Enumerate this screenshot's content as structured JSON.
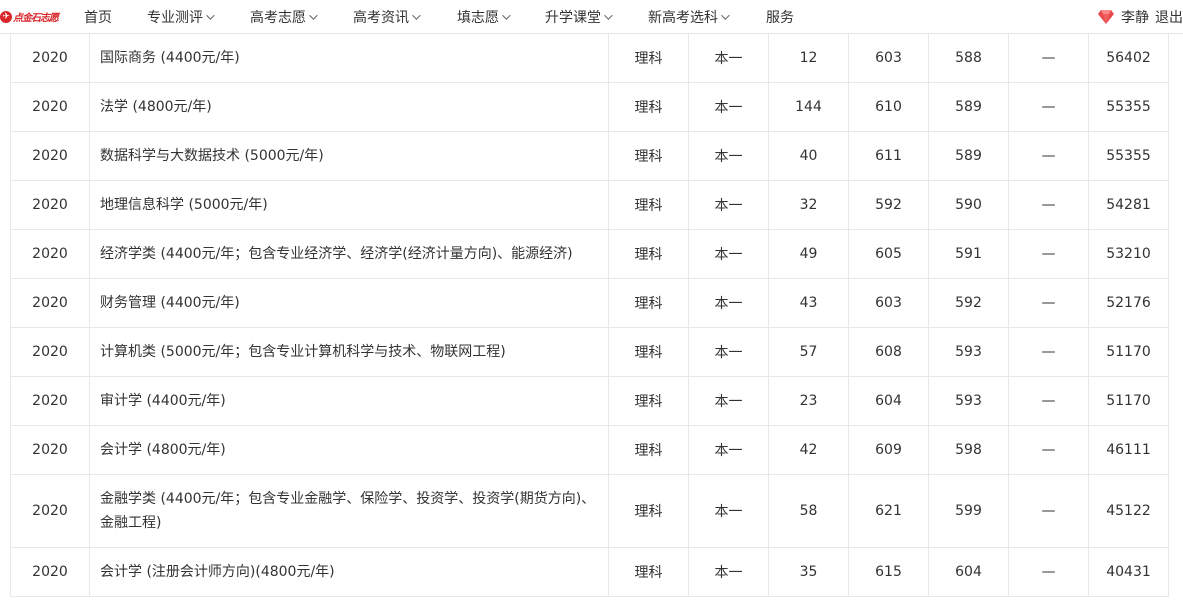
{
  "logo": {
    "text": "点金石志愿"
  },
  "nav": [
    {
      "label": "首页",
      "dropdown": false
    },
    {
      "label": "专业测评",
      "dropdown": true
    },
    {
      "label": "高考志愿",
      "dropdown": true
    },
    {
      "label": "高考资讯",
      "dropdown": true
    },
    {
      "label": "填志愿",
      "dropdown": true
    },
    {
      "label": "升学课堂",
      "dropdown": true
    },
    {
      "label": "新高考选科",
      "dropdown": true
    },
    {
      "label": "服务",
      "dropdown": false
    }
  ],
  "user": {
    "name": "李静",
    "logout": "退出",
    "badge_icon": "diamond-icon"
  },
  "table": {
    "rows": [
      {
        "year": "2020",
        "major": "国际商务 (4400元/年)",
        "subject": "理科",
        "batch": "本一",
        "plan": "12",
        "max": "603",
        "min": "588",
        "avg": "—",
        "rank": "56402"
      },
      {
        "year": "2020",
        "major": "法学 (4800元/年)",
        "subject": "理科",
        "batch": "本一",
        "plan": "144",
        "max": "610",
        "min": "589",
        "avg": "—",
        "rank": "55355"
      },
      {
        "year": "2020",
        "major": "数据科学与大数据技术 (5000元/年)",
        "subject": "理科",
        "batch": "本一",
        "plan": "40",
        "max": "611",
        "min": "589",
        "avg": "—",
        "rank": "55355"
      },
      {
        "year": "2020",
        "major": "地理信息科学 (5000元/年)",
        "subject": "理科",
        "batch": "本一",
        "plan": "32",
        "max": "592",
        "min": "590",
        "avg": "—",
        "rank": "54281"
      },
      {
        "year": "2020",
        "major": "经济学类 (4400元/年；包含专业经济学、经济学(经济计量方向)、能源经济)",
        "subject": "理科",
        "batch": "本一",
        "plan": "49",
        "max": "605",
        "min": "591",
        "avg": "—",
        "rank": "53210"
      },
      {
        "year": "2020",
        "major": "财务管理 (4400元/年)",
        "subject": "理科",
        "batch": "本一",
        "plan": "43",
        "max": "603",
        "min": "592",
        "avg": "—",
        "rank": "52176"
      },
      {
        "year": "2020",
        "major": "计算机类 (5000元/年；包含专业计算机科学与技术、物联网工程)",
        "subject": "理科",
        "batch": "本一",
        "plan": "57",
        "max": "608",
        "min": "593",
        "avg": "—",
        "rank": "51170"
      },
      {
        "year": "2020",
        "major": "审计学 (4400元/年)",
        "subject": "理科",
        "batch": "本一",
        "plan": "23",
        "max": "604",
        "min": "593",
        "avg": "—",
        "rank": "51170"
      },
      {
        "year": "2020",
        "major": "会计学 (4800元/年)",
        "subject": "理科",
        "batch": "本一",
        "plan": "42",
        "max": "609",
        "min": "598",
        "avg": "—",
        "rank": "46111"
      },
      {
        "year": "2020",
        "major": "金融学类 (4400元/年；包含专业金融学、保险学、投资学、投资学(期货方向)、金融工程)",
        "subject": "理科",
        "batch": "本一",
        "plan": "58",
        "max": "621",
        "min": "599",
        "avg": "—",
        "rank": "45122"
      },
      {
        "year": "2020",
        "major": "会计学 (注册会计师方向)(4800元/年)",
        "subject": "理科",
        "batch": "本一",
        "plan": "35",
        "max": "615",
        "min": "604",
        "avg": "—",
        "rank": "40431"
      }
    ]
  }
}
